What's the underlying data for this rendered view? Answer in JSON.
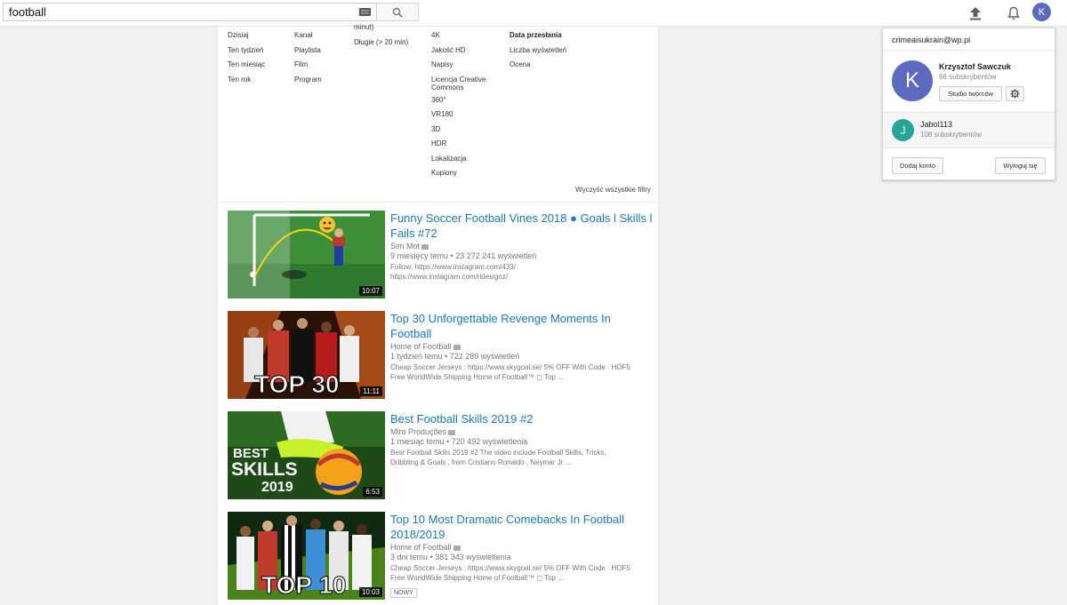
{
  "search": {
    "query": "football"
  },
  "filters": {
    "upload_date": [
      "Dzisiaj",
      "Ten tydzień",
      "Ten miesiąc",
      "Ten rok"
    ],
    "type": [
      "Kanał",
      "Playlista",
      "Film",
      "Program"
    ],
    "duration": [
      "minut)",
      "Długie (> 20 min)"
    ],
    "features": [
      "4K",
      "Jakość HD",
      "Napisy",
      "Licencja Creative Commons",
      "360°",
      "VR180",
      "3D",
      "HDR",
      "Lokalizacja",
      "Kupiony"
    ],
    "sort": [
      "Data przesłania",
      "Liczba wyświetleń",
      "Ocena"
    ],
    "clear_label": "Wyczyść wszystkie filtry"
  },
  "results": [
    {
      "title": "Funny Soccer Football Vines 2018 ● Goals l Skills l Fails #72",
      "channel": "Sim Mot",
      "age": "9 miesięcy temu",
      "views": "23 272 241 wyświetleń",
      "desc_line1": "Follow: https://www.instagram.com/433/",
      "desc_line2": "https://www.instagram.com/rldesignz/",
      "duration": "10:07",
      "badge": ""
    },
    {
      "title": "Top 30 Unforgettable Revenge Moments In Football",
      "channel": "Home of Football",
      "age": "1 tydzień temu",
      "views": "722 289 wyświetleń",
      "desc_line1": "Cheap Soccer Jerseys : https://www.skygoal.se/ 5% OFF With Code : HOF5",
      "desc_line2": "Free WorldWide Shipping Home of Football™ ◻ Top ...",
      "duration": "11:11",
      "thumb_text": "TOP 30",
      "badge": ""
    },
    {
      "title": "Best Football Skills 2019 #2",
      "channel": "Miro Produções",
      "age": "1 miesiąc temu",
      "views": "720 492 wyświetlenia",
      "desc_line1": "Best Football Skills 2019 #2 The video include Football Skills, Tricks,",
      "desc_line2": "Dribbling & Goals , from Cristiano Ronaldo , Neymar Jr ...",
      "duration": "6:53",
      "thumb_text1": "BEST",
      "thumb_text2": "SKILLS",
      "thumb_text3": "2019",
      "badge": ""
    },
    {
      "title": "Top 10 Most Dramatic Comebacks In Football 2018/2019",
      "channel": "Home of Football",
      "age": "3 dni temu",
      "views": "381 343 wyświetlenia",
      "desc_line1": "Cheap Soccer Jerseys : https://www.skygoal.se/ 5% OFF With Code : HOF5",
      "desc_line2": "Free WorldWide Shipping Home of Football™ ◻ Top ...",
      "duration": "10:03",
      "thumb_text": "TOP 10",
      "badge": "NOWY"
    }
  ],
  "account": {
    "avatar_letter": "K",
    "email": "crimeaisukrain@wp.pl",
    "name": "Krzysztof Sawczuk",
    "subscribers": "66 subskrybentów",
    "studio_label": "Studio twórców",
    "alt_letter": "J",
    "alt_name": "Jabol113",
    "alt_subscribers": "108 subskrybentów",
    "add_account_label": "Dodaj konto",
    "logout_label": "Wyloguj się"
  },
  "colors": {
    "link": "#167ac6",
    "avatar_primary": "#5c6bc0",
    "avatar_secondary": "#26a69a"
  }
}
